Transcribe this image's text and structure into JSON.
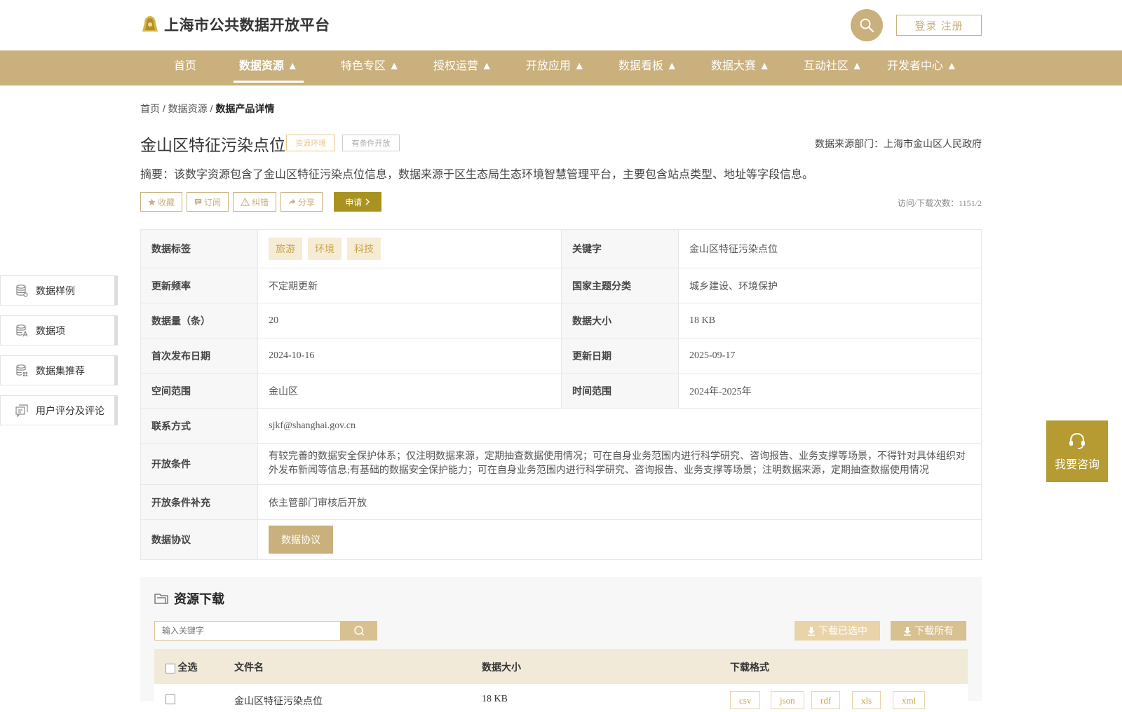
{
  "header": {
    "site_title": "上海市公共数据开放平台",
    "login_label": "登录 注册"
  },
  "nav": {
    "items": [
      {
        "label": "首页"
      },
      {
        "label": "数据资源 ▲"
      },
      {
        "label": "特色专区 ▲"
      },
      {
        "label": "授权运营 ▲"
      },
      {
        "label": "开放应用 ▲"
      },
      {
        "label": "数据看板 ▲"
      },
      {
        "label": "数据大赛 ▲"
      },
      {
        "label": "互动社区 ▲"
      },
      {
        "label": "开发者中心 ▲"
      }
    ]
  },
  "breadcrumb": {
    "home": "首页",
    "sep1": " / ",
    "resources": "数据资源",
    "sep2": " / ",
    "current": "数据产品详情"
  },
  "detail": {
    "title": "金山区特征污染点位",
    "tag_domain": "资源环境",
    "tag_open": "有条件开放",
    "source": "数据来源部门：上海市金山区人民政府",
    "summary": "摘要：该数字资源包含了金山区特征污染点位信息，数据来源于区生态局生态环境智慧管理平台，主要包含站点类型、地址等字段信息。",
    "actions": {
      "favorite": "收藏",
      "subscribe": "订阅",
      "correct": "纠错",
      "share": "分享",
      "apply": "申请"
    },
    "visits": "访问/下载次数：1151/2"
  },
  "info": {
    "tags_label": "数据标签",
    "tags": [
      "旅游",
      "环境",
      "科技"
    ],
    "keyword_label": "关键字",
    "keyword": "金山区特征污染点位",
    "freq_label": "更新频率",
    "freq": "不定期更新",
    "theme_label": "国家主题分类",
    "theme": "城乡建设、环境保护",
    "count_label": "数据量（条）",
    "count": "20",
    "size_label": "数据大小",
    "size": "18 KB",
    "first_label": "首次发布日期",
    "first": "2024-10-16",
    "updated_label": "更新日期",
    "updated": "2025-09-17",
    "space_label": "空间范围",
    "space": "金山区",
    "time_label": "时间范围",
    "time": "2024年-2025年",
    "contact_label": "联系方式",
    "contact": "sjkf@shanghai.gov.cn",
    "cond_label": "开放条件",
    "cond": "有较完善的数据安全保护体系；仅注明数据来源，定期抽查数据使用情况；可在自身业务范围内进行科学研究、咨询报告、业务支撑等场景，不得针对具体组织对外发布新闻等信息;有基础的数据安全保护能力；可在自身业务范围内进行科学研究、咨询报告、业务支撑等场景；注明数据来源，定期抽查数据使用情况",
    "cond_extra_label": "开放条件补充",
    "cond_extra": "依主管部门审核后开放",
    "protocol_label": "数据协议",
    "protocol_btn": "数据协议"
  },
  "sidebar": {
    "items": [
      {
        "label": "数据样例"
      },
      {
        "label": "数据项"
      },
      {
        "label": "数据集推荐"
      },
      {
        "label": "用户评分及评论"
      }
    ]
  },
  "consult": {
    "label": "我要咨询"
  },
  "download": {
    "title": "资源下载",
    "search_placeholder": "输入关键字",
    "download_selected": "下载已选中",
    "download_all": "下载所有",
    "columns": {
      "select_all": "全选",
      "filename": "文件名",
      "size": "数据大小",
      "format": "下载格式"
    },
    "rows": [
      {
        "filename": "金山区特征污染点位",
        "size": "18 KB",
        "formats": [
          "csv",
          "json",
          "rdf",
          "xls",
          "xml"
        ]
      }
    ]
  },
  "colors": {
    "accent": "#c9b07c",
    "apply": "#a9921f",
    "consult": "#b59b32"
  }
}
